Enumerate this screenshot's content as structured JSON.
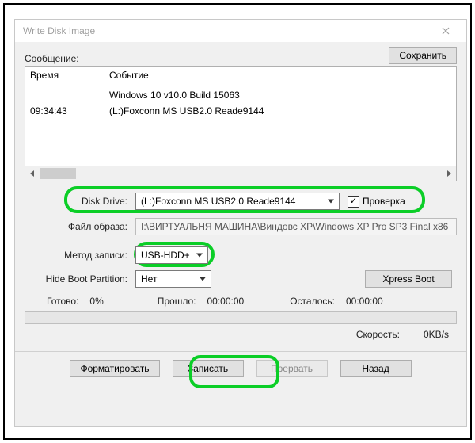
{
  "window": {
    "title": "Write Disk Image"
  },
  "toolbar": {
    "message_label": "Сообщение:",
    "save_label": "Сохранить"
  },
  "log": {
    "columns": {
      "time": "Время",
      "event": "Событие"
    },
    "rows": [
      {
        "time": "",
        "event": "Windows 10 v10.0 Build 15063"
      },
      {
        "time": "09:34:43",
        "event": "(L:)Foxconn MS  USB2.0 Reade9144"
      }
    ]
  },
  "form": {
    "disk_drive": {
      "label": "Disk Drive:",
      "value": "(L:)Foxconn MS  USB2.0 Reade9144",
      "verify_label": "Проверка",
      "verify_checked": true
    },
    "image_file": {
      "label": "Файл образа:",
      "value": "I:\\ВИРТУАЛЬНЯ МАШИНА\\Виндовс XP\\Windows XP Pro SP3 Final x86"
    },
    "write_method": {
      "label": "Метод записи:",
      "value": "USB-HDD+"
    },
    "hide_boot": {
      "label": "Hide Boot Partition:",
      "value": "Нет",
      "xpress_label": "Xpress Boot"
    }
  },
  "progress": {
    "ready_label": "Готово:",
    "ready_value": "0%",
    "elapsed_label": "Прошло:",
    "elapsed_value": "00:00:00",
    "remaining_label": "Осталось:",
    "remaining_value": "00:00:00",
    "speed_label": "Скорость:",
    "speed_value": "0KB/s"
  },
  "actions": {
    "format": "Форматировать",
    "write": "Записать",
    "abort": "Прервать",
    "back": "Назад"
  }
}
